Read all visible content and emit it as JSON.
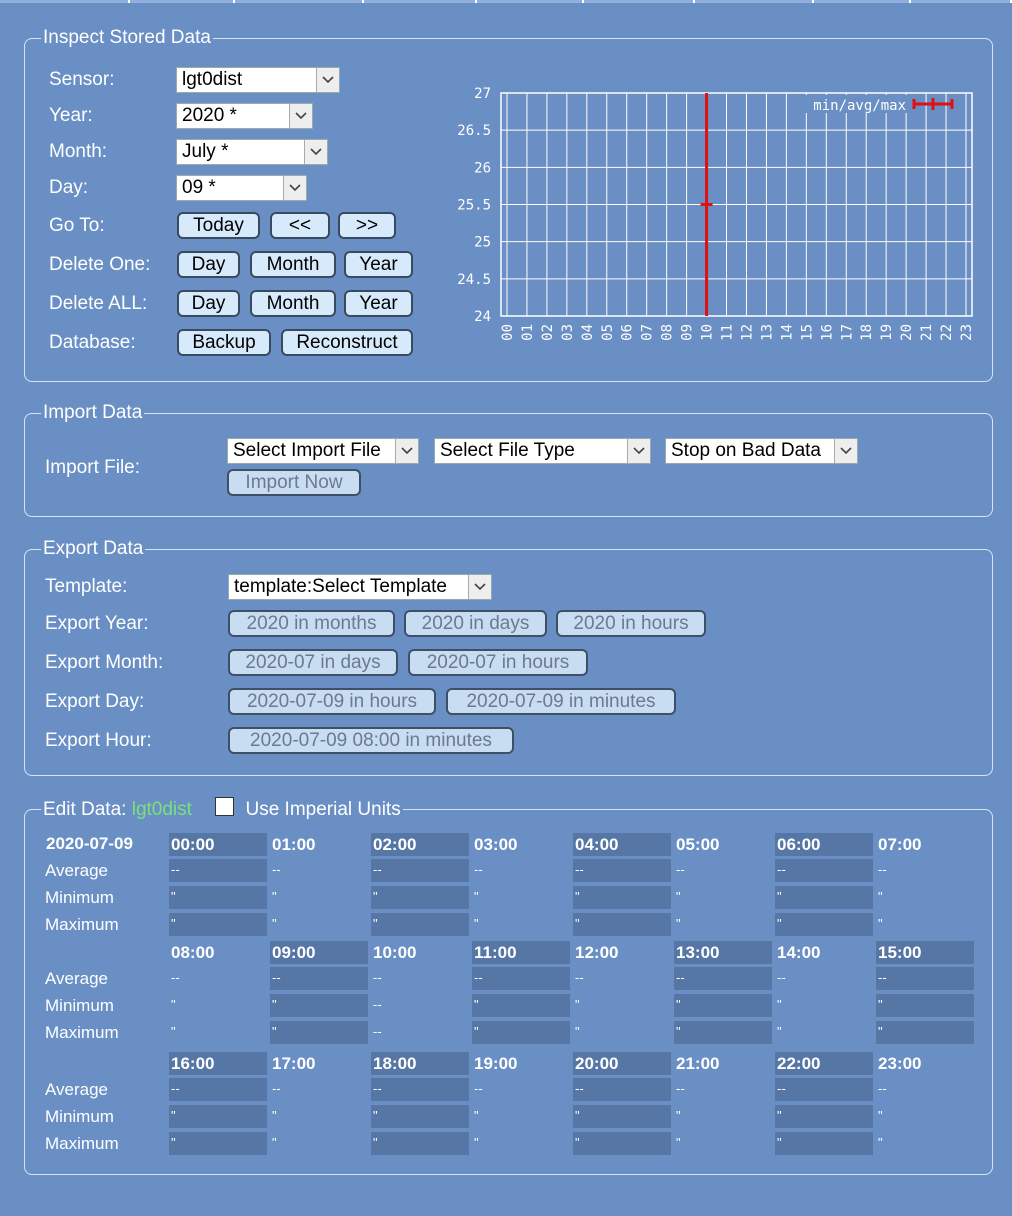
{
  "inspect": {
    "legend": "Inspect Stored Data",
    "sensor_label": "Sensor:",
    "sensor_value": "lgt0dist",
    "year_label": "Year:",
    "year_value": "2020 *",
    "month_label": "Month:",
    "month_value": "July *",
    "day_label": "Day:",
    "day_value": "09 *",
    "goto_label": "Go To:",
    "goto_today": "Today",
    "goto_prev": "<<",
    "goto_next": ">>",
    "delete_one_label": "Delete One:",
    "delete_all_label": "Delete ALL:",
    "btn_day": "Day",
    "btn_month": "Month",
    "btn_year": "Year",
    "database_label": "Database:",
    "btn_backup": "Backup",
    "btn_reconstruct": "Reconstruct"
  },
  "chart_data": {
    "type": "line",
    "x": [
      "00",
      "01",
      "02",
      "03",
      "04",
      "05",
      "06",
      "07",
      "08",
      "09",
      "10",
      "11",
      "12",
      "13",
      "14",
      "15",
      "16",
      "17",
      "18",
      "19",
      "20",
      "21",
      "22",
      "23"
    ],
    "yticks": [
      "27",
      "26.5",
      "26",
      "25.5",
      "25",
      "24.5",
      "24"
    ],
    "ylim": [
      24,
      27
    ],
    "legend_label": "min/avg/max",
    "legend_placement": "top-right",
    "grid": true,
    "series_color": "#e01010",
    "points": [
      {
        "x": "10",
        "min": 24,
        "avg": 25.5,
        "max": 27
      }
    ]
  },
  "import": {
    "legend": "Import Data",
    "file_label": "Import File:",
    "select_file": "Select Import File",
    "select_type": "Select File Type",
    "stop_option": "Stop on Bad Data",
    "import_now": "Import Now"
  },
  "export": {
    "legend": "Export Data",
    "template_label": "Template:",
    "template_value": "template:Select Template",
    "year_label": "Export Year:",
    "year_months": "2020 in months",
    "year_days": "2020 in days",
    "year_hours": "2020 in hours",
    "month_label": "Export Month:",
    "month_days": "2020-07 in days",
    "month_hours": "2020-07 in hours",
    "day_label": "Export Day:",
    "day_hours": "2020-07-09 in hours",
    "day_minutes": "2020-07-09 in minutes",
    "hour_label": "Export Hour:",
    "hour_minutes": "2020-07-09 08:00 in minutes"
  },
  "edit": {
    "legend_prefix": "Edit Data:",
    "sensor": "lgt0dist",
    "sensor_color": "#7be07b",
    "imperial_label": "Use Imperial Units",
    "date": "2020-07-09",
    "row_average": "Average",
    "row_minimum": "Minimum",
    "row_maximum": "Maximum",
    "hours": [
      "00:00",
      "01:00",
      "02:00",
      "03:00",
      "04:00",
      "05:00",
      "06:00",
      "07:00",
      "08:00",
      "09:00",
      "10:00",
      "11:00",
      "12:00",
      "13:00",
      "14:00",
      "15:00",
      "16:00",
      "17:00",
      "18:00",
      "19:00",
      "20:00",
      "21:00",
      "22:00",
      "23:00"
    ],
    "average_values": [
      "--",
      "--",
      "--",
      "--",
      "--",
      "--",
      "--",
      "--",
      "--",
      "--",
      "--",
      "--",
      "--",
      "--",
      "--",
      "--",
      "--",
      "--",
      "--",
      "--",
      "--",
      "--",
      "--",
      "--"
    ],
    "minimum_values": [
      "\"",
      "\"",
      "\"",
      "\"",
      "\"",
      "\"",
      "\"",
      "\"",
      "\"",
      "\"",
      "--",
      "\"",
      "\"",
      "\"",
      "\"",
      "\"",
      "\"",
      "\"",
      "\"",
      "\"",
      "\"",
      "\"",
      "\"",
      "\""
    ],
    "maximum_values": [
      "\"",
      "\"",
      "\"",
      "\"",
      "\"",
      "\"",
      "\"",
      "\"",
      "\"",
      "\"",
      "--",
      "\"",
      "\"",
      "\"",
      "\"",
      "\"",
      "\"",
      "\"",
      "\"",
      "\"",
      "\"",
      "\"",
      "\"",
      "\""
    ]
  }
}
